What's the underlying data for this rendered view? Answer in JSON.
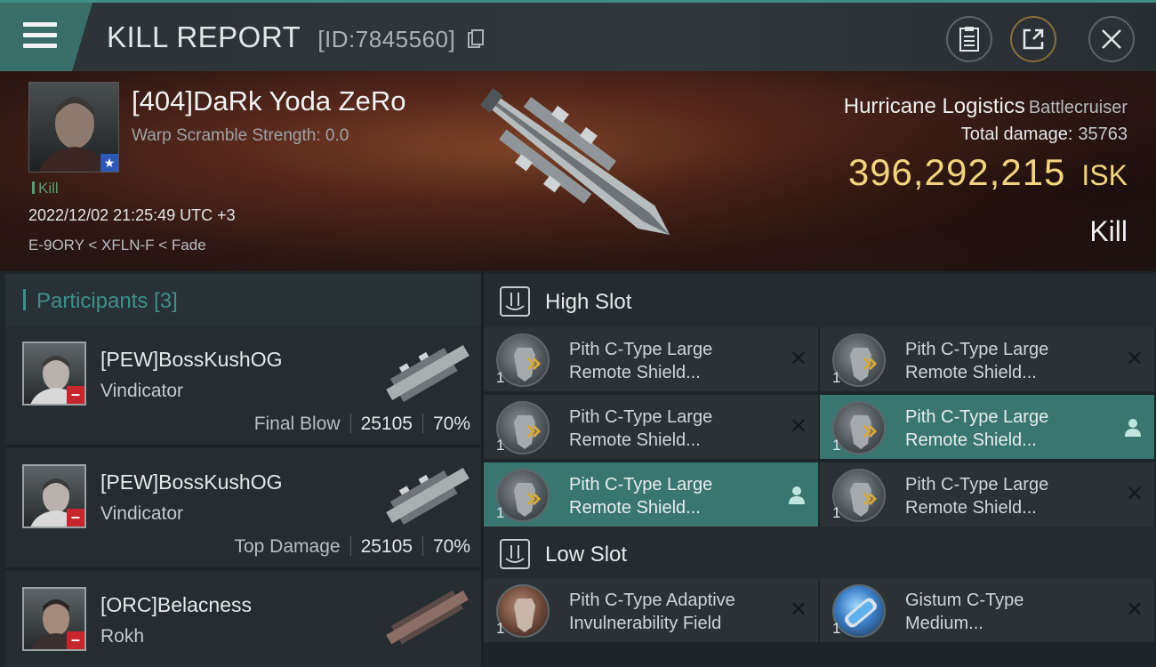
{
  "header": {
    "title": "KILL REPORT",
    "report_id": "[ID:7845560]"
  },
  "victim": {
    "name": "[404]DaRk Yoda ZeRo",
    "warp_scramble": "Warp Scramble Strength: 0.0",
    "tag": "Kill",
    "datetime": "2022/12/02 21:25:49 UTC +3",
    "route": "E-9ORY < XFLN-F < Fade",
    "ship_name": "Hurricane Logistics",
    "ship_class": "Battlecruiser",
    "total_damage_label": "Total damage:",
    "total_damage_value": "35763",
    "isk_value": "396,292,215",
    "isk_unit": "ISK",
    "result": "Kill"
  },
  "participants": {
    "title": "Participants [3]",
    "rows": [
      {
        "name": "[PEW]BossKushOG",
        "ship": "Vindicator",
        "label": "Final Blow",
        "damage": "25105",
        "percent": "70%"
      },
      {
        "name": "[PEW]BossKushOG",
        "ship": "Vindicator",
        "label": "Top Damage",
        "damage": "25105",
        "percent": "70%"
      },
      {
        "name": "[ORC]Belacness",
        "ship": "Rokh",
        "label": "",
        "damage": "",
        "percent": ""
      }
    ]
  },
  "fittings": {
    "high_slot": {
      "title": "High Slot",
      "modules": [
        {
          "qty": "1",
          "line1": "Pith C-Type Large",
          "line2": "Remote Shield...",
          "active": false
        },
        {
          "qty": "1",
          "line1": "Pith C-Type Large",
          "line2": "Remote Shield...",
          "active": false
        },
        {
          "qty": "1",
          "line1": "Pith C-Type Large",
          "line2": "Remote Shield...",
          "active": false
        },
        {
          "qty": "1",
          "line1": "Pith C-Type Large",
          "line2": "Remote Shield...",
          "active": true
        },
        {
          "qty": "1",
          "line1": "Pith C-Type Large",
          "line2": "Remote Shield...",
          "active": true
        },
        {
          "qty": "1",
          "line1": "Pith C-Type Large",
          "line2": "Remote Shield...",
          "active": false
        }
      ]
    },
    "low_slot": {
      "title": "Low Slot",
      "modules": [
        {
          "qty": "1",
          "line1": "Pith C-Type Adaptive",
          "line2": "Invulnerability Field",
          "active": false
        },
        {
          "qty": "1",
          "line1": "Gistum C-Type",
          "line2": "Medium...",
          "active": false
        }
      ]
    }
  },
  "colors": {
    "accent_teal": "#3e8f8a",
    "isk_gold": "#f2d37f",
    "active_module": "#3a7670",
    "enemy_badge": "#c8262c"
  }
}
